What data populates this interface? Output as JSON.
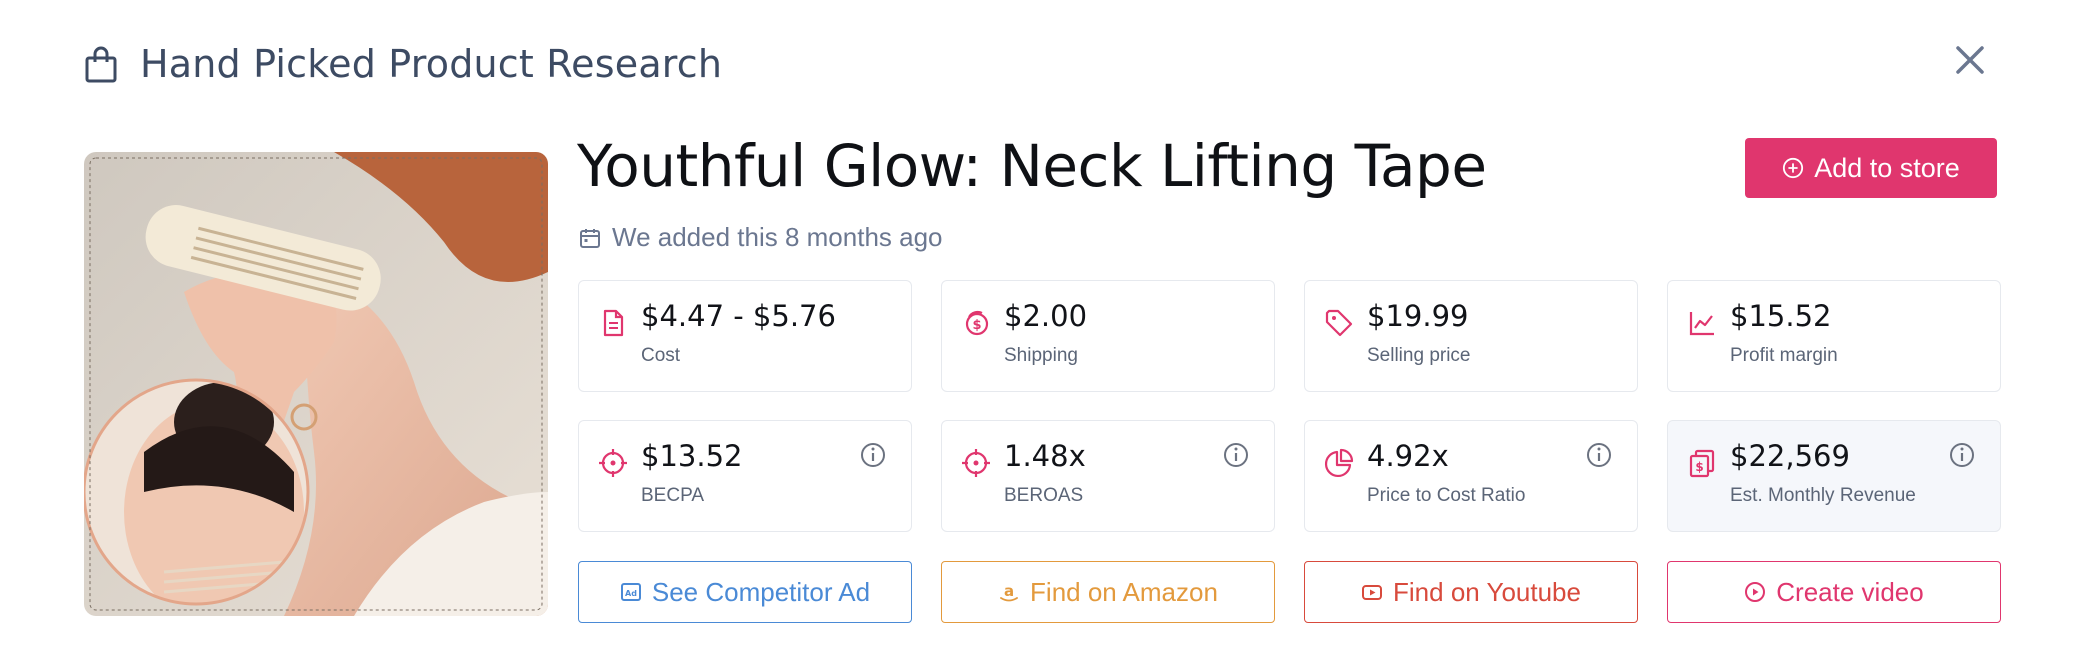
{
  "header": {
    "title": "Hand Picked Product Research",
    "icon": "shopping-bag-icon"
  },
  "product": {
    "title": "Youthful Glow: Neck Lifting Tape",
    "added_text": "We added this 8 months ago",
    "add_button_label": "Add to store"
  },
  "stats": [
    {
      "value": "$4.47 - $5.76",
      "label": "Cost",
      "icon": "document-icon"
    },
    {
      "value": "$2.00",
      "label": "Shipping",
      "icon": "coins-icon"
    },
    {
      "value": "$19.99",
      "label": "Selling price",
      "icon": "price-tag-icon"
    },
    {
      "value": "$15.52",
      "label": "Profit margin",
      "icon": "line-chart-icon"
    },
    {
      "value": "$13.52",
      "label": "BECPA",
      "icon": "crosshair-icon",
      "info": true
    },
    {
      "value": "1.48x",
      "label": "BEROAS",
      "icon": "crosshair-icon",
      "info": true
    },
    {
      "value": "4.92x",
      "label": "Price to Cost Ratio",
      "icon": "pie-chart-icon",
      "info": true
    },
    {
      "value": "$22,569",
      "label": "Est. Monthly Revenue",
      "icon": "revenue-icon",
      "info": true
    }
  ],
  "actions": [
    {
      "label": "See Competitor Ad",
      "icon": "ad-icon",
      "color": "#4a8ad6"
    },
    {
      "label": "Find on Amazon",
      "icon": "amazon-icon",
      "color": "#e39a3d"
    },
    {
      "label": "Find on Youtube",
      "icon": "youtube-icon",
      "color": "#d84a3c"
    },
    {
      "label": "Create video",
      "icon": "play-circle-icon",
      "color": "#e0366e"
    }
  ],
  "colors": {
    "accent": "#e0366e",
    "title": "#3d4b63",
    "muted": "#6b7790"
  }
}
